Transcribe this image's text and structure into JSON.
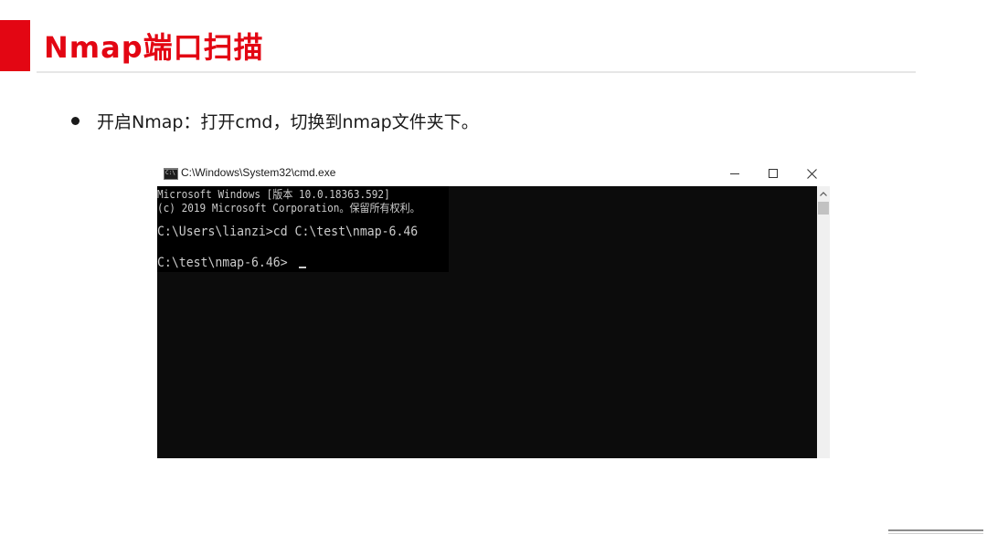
{
  "slide": {
    "title": "Nmap端口扫描",
    "bullet": "开启Nmap：打开cmd，切换到nmap文件夹下。",
    "accent_color": "#e30613"
  },
  "window": {
    "title": "C:\\Windows\\System32\\cmd.exe",
    "icon_text": "C:\\",
    "controls": {
      "minimize": "minimize-icon",
      "maximize": "maximize-icon",
      "close": "close-icon"
    }
  },
  "console": {
    "lines": [
      "Microsoft Windows [版本 10.0.18363.592]",
      "(c) 2019 Microsoft Corporation。保留所有权利。",
      "C:\\Users\\lianzi>cd C:\\test\\nmap-6.46",
      "C:\\test\\nmap-6.46>"
    ]
  }
}
